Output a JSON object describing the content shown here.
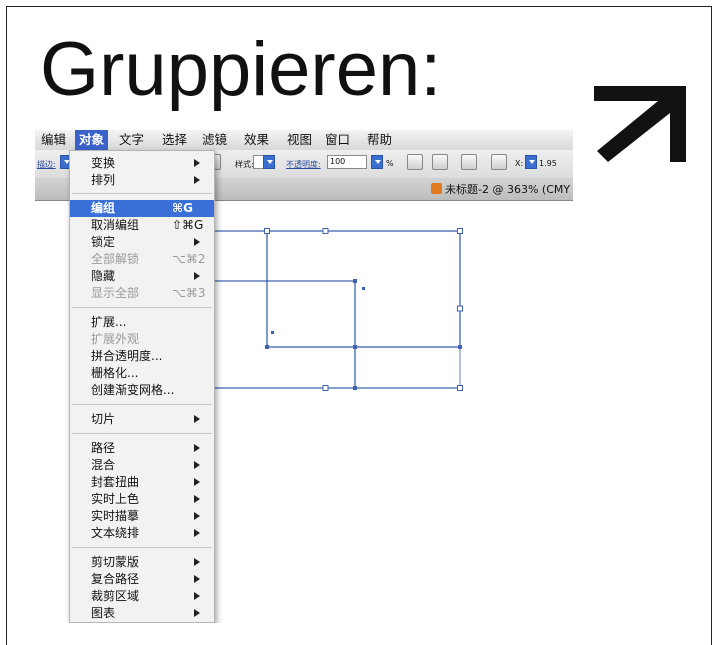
{
  "slide": {
    "title": "Gruppieren:"
  },
  "menubar": {
    "items": [
      {
        "label": "编辑"
      },
      {
        "label": "对象"
      },
      {
        "label": "文字"
      },
      {
        "label": "选择"
      },
      {
        "label": "滤镜"
      },
      {
        "label": "效果"
      },
      {
        "label": "视图"
      },
      {
        "label": "窗口"
      },
      {
        "label": "帮助"
      }
    ]
  },
  "controlbar": {
    "stroke_label": "描边:",
    "style_label": "样式:",
    "opacity_label": "不透明度:",
    "opacity_value": "100",
    "percent": "%",
    "x_label": "X:",
    "x_value": "1.95"
  },
  "document": {
    "tab_title": "未标题-2 @ 363% (CMY"
  },
  "menu": {
    "items": [
      {
        "label": "变换",
        "shortcut": ""
      },
      {
        "label": "排列",
        "shortcut": ""
      },
      {
        "label": "编组",
        "shortcut": "⌘G"
      },
      {
        "label": "取消编组",
        "shortcut": "⇧⌘G"
      },
      {
        "label": "锁定",
        "shortcut": ""
      },
      {
        "label": "全部解锁",
        "shortcut": "⌥⌘2"
      },
      {
        "label": "隐藏",
        "shortcut": ""
      },
      {
        "label": "显示全部",
        "shortcut": "⌥⌘3"
      },
      {
        "label": "扩展...",
        "shortcut": ""
      },
      {
        "label": "扩展外观",
        "shortcut": ""
      },
      {
        "label": "拼合透明度...",
        "shortcut": ""
      },
      {
        "label": "栅格化...",
        "shortcut": ""
      },
      {
        "label": "创建渐变网格...",
        "shortcut": ""
      },
      {
        "label": "切片",
        "shortcut": ""
      },
      {
        "label": "路径",
        "shortcut": ""
      },
      {
        "label": "混合",
        "shortcut": ""
      },
      {
        "label": "封套扭曲",
        "shortcut": ""
      },
      {
        "label": "实时上色",
        "shortcut": ""
      },
      {
        "label": "实时描摹",
        "shortcut": ""
      },
      {
        "label": "文本绕排",
        "shortcut": ""
      },
      {
        "label": "剪切蒙版",
        "shortcut": ""
      },
      {
        "label": "复合路径",
        "shortcut": ""
      },
      {
        "label": "裁剪区域",
        "shortcut": ""
      },
      {
        "label": "图表",
        "shortcut": ""
      }
    ]
  },
  "colors": {
    "menu_highlight": "#3a6fd8",
    "selection": "#3d63b0"
  }
}
